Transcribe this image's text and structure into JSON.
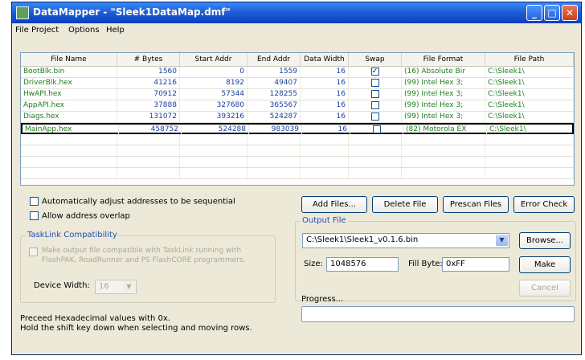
{
  "window": {
    "title": "DataMapper - \"Sleek1DataMap.dmf\"",
    "minimize_glyph": "_",
    "maximize_glyph": "□",
    "close_glyph": "✕"
  },
  "menu": [
    "File",
    "Project",
    "Options",
    "Help"
  ],
  "table": {
    "columns": [
      "File Name",
      "# Bytes",
      "Start Addr",
      "End Addr",
      "Data Width",
      "Swap",
      "File Format",
      "File Path"
    ],
    "rows": [
      {
        "file_name": "BootBlk.bin",
        "bytes": "1560",
        "start": "0",
        "end": "1559",
        "width": "16",
        "swap": true,
        "format": "(16) Absolute Bir",
        "path": "C:\\Sleek1\\"
      },
      {
        "file_name": "DriverBlk.hex",
        "bytes": "41216",
        "start": "8192",
        "end": "49407",
        "width": "16",
        "swap": false,
        "format": "(99) Intel Hex 3;",
        "path": "C:\\Sleek1\\"
      },
      {
        "file_name": "HwAPI.hex",
        "bytes": "70912",
        "start": "57344",
        "end": "128255",
        "width": "16",
        "swap": false,
        "format": "(99) Intel Hex 3;",
        "path": "C:\\Sleek1\\"
      },
      {
        "file_name": "AppAPI.hex",
        "bytes": "37888",
        "start": "327680",
        "end": "365567",
        "width": "16",
        "swap": false,
        "format": "(99) Intel Hex 3;",
        "path": "C:\\Sleek1\\"
      },
      {
        "file_name": "Diags.hex",
        "bytes": "131072",
        "start": "393216",
        "end": "524287",
        "width": "16",
        "swap": false,
        "format": "(99) Intel Hex 3;",
        "path": "C:\\Sleek1\\"
      },
      {
        "file_name": "MainApp.hex",
        "bytes": "458752",
        "start": "524288",
        "end": "983039",
        "width": "16",
        "swap": false,
        "format": "(82) Motorola EX",
        "path": "C:\\Sleek1\\"
      }
    ],
    "selected_row": 5,
    "check_glyph": "✓"
  },
  "options": {
    "auto_adjust": {
      "label": "Automatically adjust addresses to be sequential",
      "checked": false
    },
    "allow_overlap": {
      "label": "Allow address overlap",
      "checked": false
    }
  },
  "tasklink": {
    "legend": "TaskLink Compatibility",
    "checkbox_label_line1": "Make output file compatible with TaskLink running with",
    "checkbox_label_line2": "FlashPAK, RoadRunner and PS FlashCORE programmers.",
    "device_width_label": "Device Width:",
    "device_width_value": "16",
    "arrow_glyph": "▼"
  },
  "file_buttons": {
    "add": "Add Files...",
    "delete": "Delete File",
    "prescan": "Prescan Files",
    "error_check": "Error Check"
  },
  "output": {
    "legend": "Output File",
    "path": "C:\\Sleek1\\Sleek1_v0.1.6.bin",
    "arrow_glyph": "▼",
    "browse": "Browse...",
    "size_label": "Size:",
    "size_value": "1048576",
    "fill_label": "Fill Byte:",
    "fill_value": "0xFF",
    "make": "Make",
    "cancel": "Cancel"
  },
  "hints": {
    "line1": "Preceed Hexadecimal values with 0x.",
    "line2": "Hold the shift key down when selecting and moving rows."
  },
  "progress": {
    "label": "Progress...",
    "value": 0
  }
}
